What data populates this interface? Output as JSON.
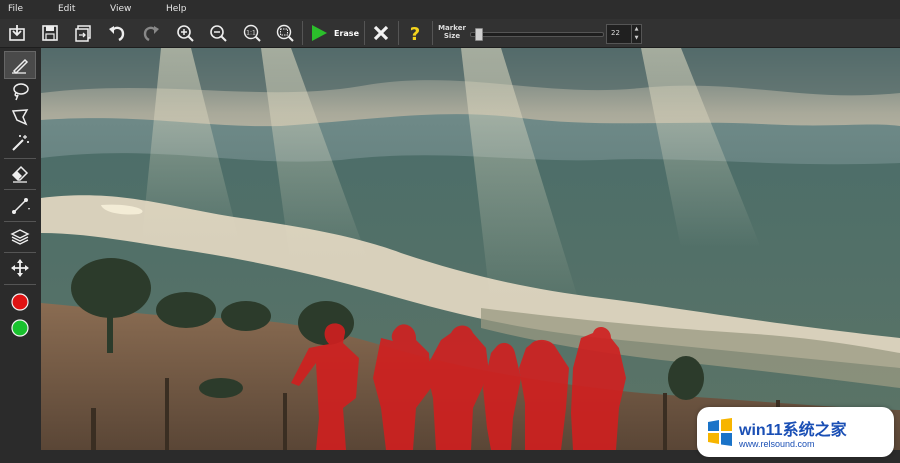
{
  "menu": {
    "file": "File",
    "edit": "Edit",
    "view": "View",
    "help": "Help"
  },
  "toolbar": {
    "erase_label": "Erase",
    "marker_size_label_1": "Marker",
    "marker_size_label_2": "Size",
    "marker_size_value": "22",
    "marker_size_fraction": 0.04
  },
  "colors": {
    "mask": "#d11f1f",
    "accent_play": "#2bbf2b",
    "help_yellow": "#f5d41c"
  },
  "watermark": {
    "text": "win11系统之家",
    "url": "www.relsound.com"
  }
}
